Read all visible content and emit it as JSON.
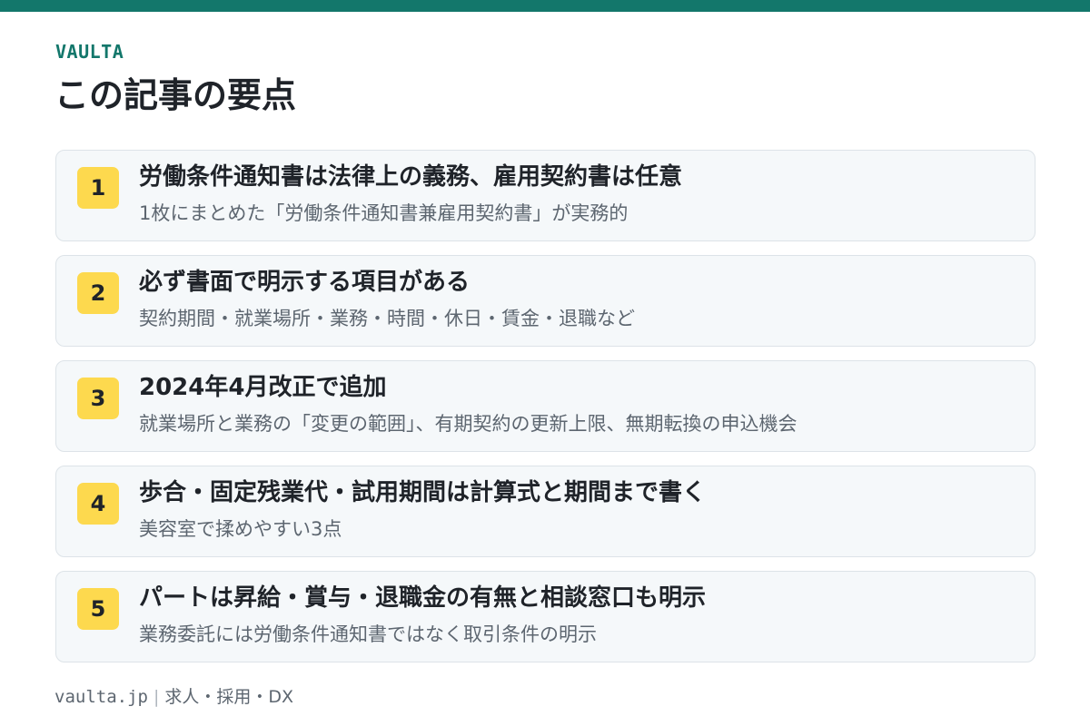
{
  "colors": {
    "accent": "#13776b",
    "badge": "#fdd94e",
    "card_bg": "#f5f8fa",
    "card_border": "#dde3e8",
    "title_text": "#1f2329",
    "sub_text": "#5d6670"
  },
  "header": {
    "brand": "VAULTA",
    "title": "この記事の要点"
  },
  "points": [
    {
      "number": "1",
      "title": "労働条件通知書は法律上の義務、雇用契約書は任意",
      "subtitle": "1枚にまとめた「労働条件通知書兼雇用契約書」が実務的"
    },
    {
      "number": "2",
      "title": "必ず書面で明示する項目がある",
      "subtitle": "契約期間・就業場所・業務・時間・休日・賃金・退職など"
    },
    {
      "number": "3",
      "title": "2024年4月改正で追加",
      "subtitle": "就業場所と業務の「変更の範囲」、有期契約の更新上限、無期転換の申込機会"
    },
    {
      "number": "4",
      "title": "歩合・固定残業代・試用期間は計算式と期間まで書く",
      "subtitle": "美容室で揉めやすい3点"
    },
    {
      "number": "5",
      "title": "パートは昇給・賞与・退職金の有無と相談窓口も明示",
      "subtitle": "業務委託には労働条件通知書ではなく取引条件の明示"
    }
  ],
  "footer": {
    "domain": "vaulta.jp",
    "separator": "|",
    "tagline": "求人・採用・DX"
  }
}
